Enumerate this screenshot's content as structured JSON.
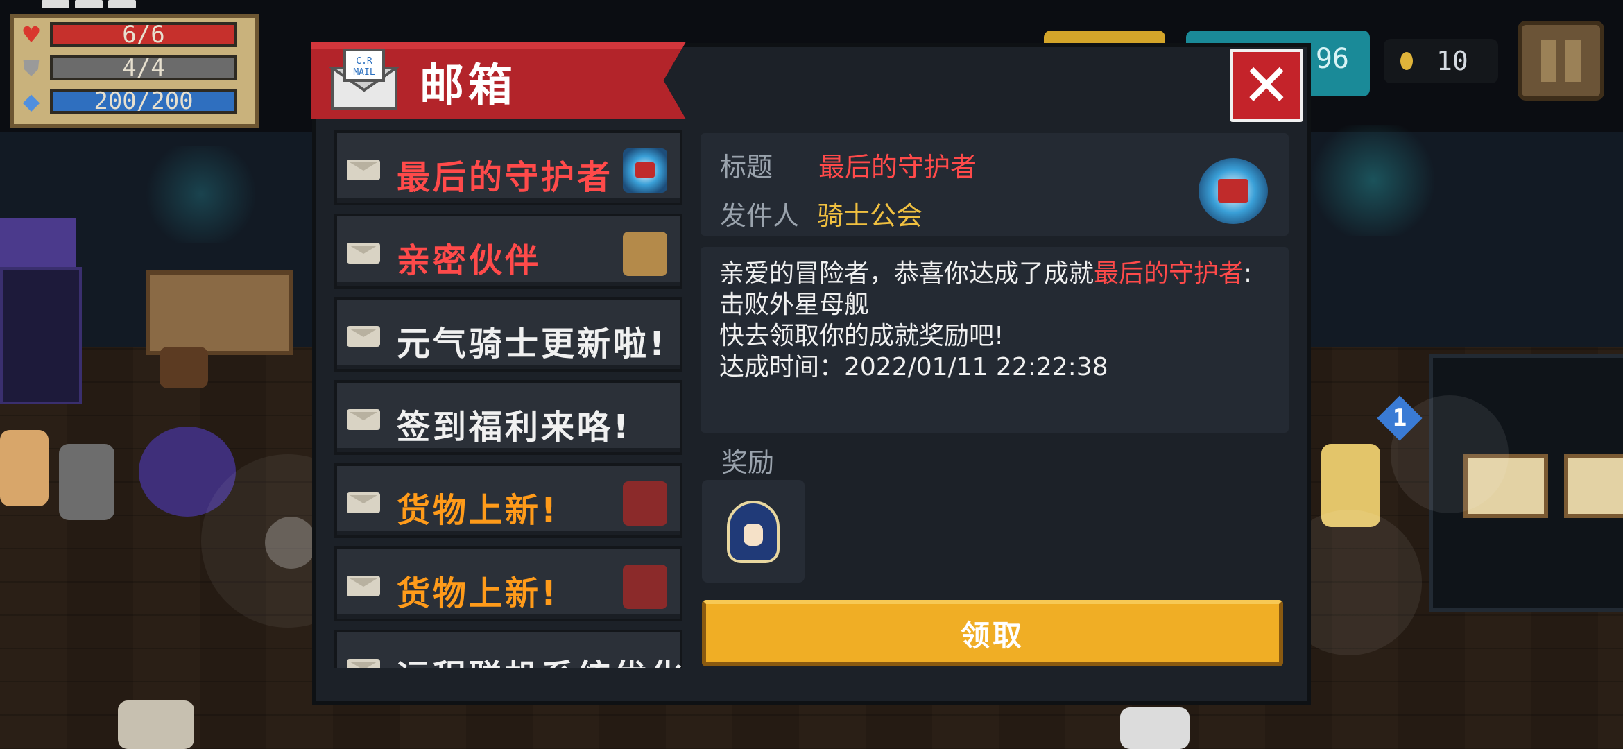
{
  "hud": {
    "hp": "6/6",
    "armor": "4/4",
    "energy": "200/200",
    "coins": "10",
    "gems_partial": "96",
    "icons": [
      "heart-icon",
      "shield-icon",
      "energy-crystal-icon",
      "coin-icon",
      "pause-icon"
    ],
    "weapon_badge": "1"
  },
  "mailbox": {
    "title": "邮箱",
    "close_icon": "close-x-icon",
    "items": [
      {
        "label": "最后的守护者",
        "color": "#ff4a4a",
        "thumb": "guardian-orb-icon"
      },
      {
        "label": "亲密伙伴",
        "color": "#ff4a4a",
        "thumb": "pet-fox-icon"
      },
      {
        "label": "元气骑士更新啦!",
        "color": "#f0f0f0",
        "thumb": ""
      },
      {
        "label": "签到福利来咯!",
        "color": "#f0f0f0",
        "thumb": ""
      },
      {
        "label": "货物上新!",
        "color": "#ff9b1a",
        "thumb": "knight-merchant-icon"
      },
      {
        "label": "货物上新!",
        "color": "#ff9b1a",
        "thumb": "knight-merchant-icon"
      },
      {
        "label": "远程联机系统优化",
        "color": "#f0f0f0",
        "thumb": ""
      }
    ],
    "detail": {
      "title_key": "标题",
      "title_value": "最后的守护者",
      "sender_key": "发件人",
      "sender_value": "骑士公会",
      "body_part1": "亲爱的冒险者，恭喜你达成了成就",
      "body_highlight": "最后的守护者",
      "body_part2": ":击败外星母舰",
      "body_line2": "快去领取你的成就奖励吧!",
      "body_line3": "达成时间：2022/01/11 22:22:38",
      "reward_label": "奖励",
      "reward_icon": "character-skin-icon",
      "claim_label": "领取"
    }
  }
}
